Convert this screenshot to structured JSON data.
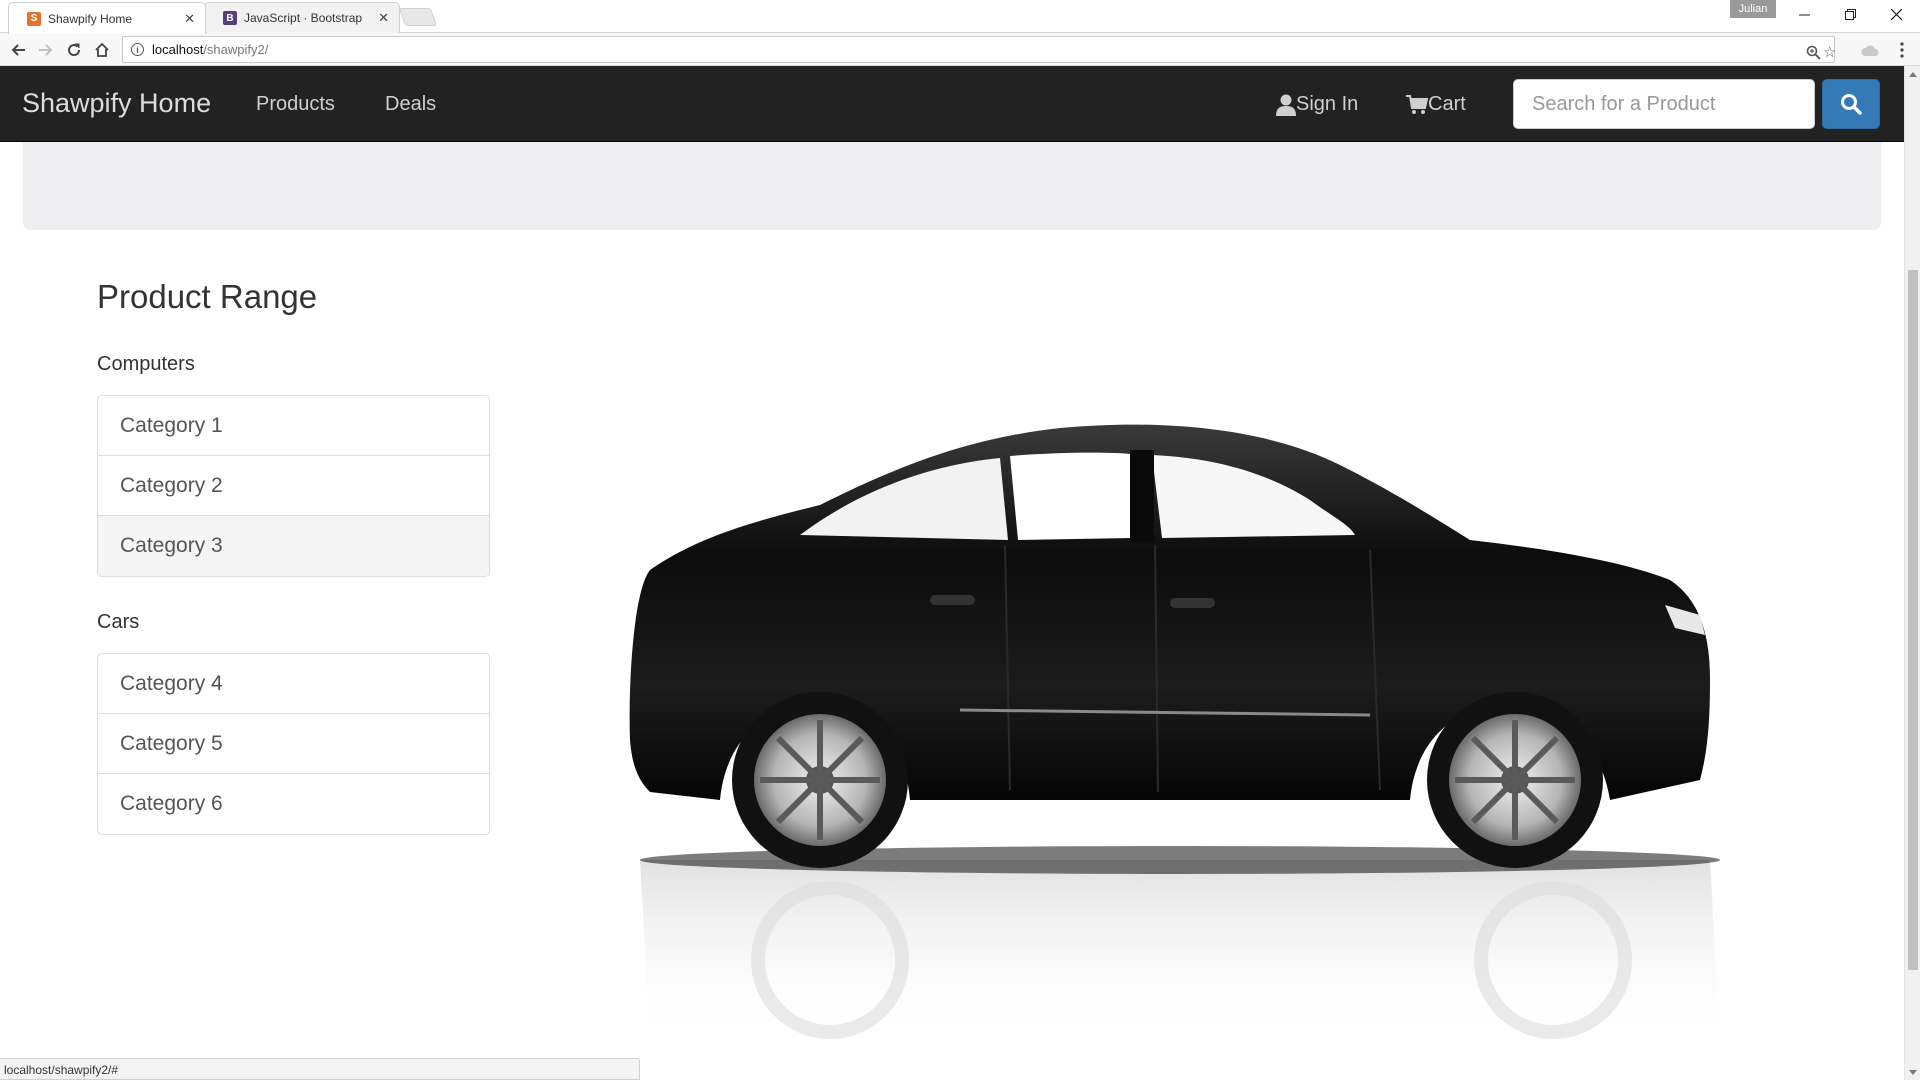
{
  "browser": {
    "tabs": [
      {
        "title": "Shawpify Home",
        "favicon_color": "#e2732b",
        "favicon_glyph": "S",
        "active": true
      },
      {
        "title": "JavaScript · Bootstrap",
        "favicon_color": "#563d7c",
        "favicon_glyph": "B",
        "active": false
      }
    ],
    "profile_name": "Julian",
    "address": {
      "host": "localhost",
      "path": "/shawpify2/"
    },
    "status_url": "localhost/shawpify2/#"
  },
  "navbar": {
    "brand": "Shawpify Home",
    "links": [
      "Products",
      "Deals"
    ],
    "sign_in": "Sign In",
    "cart": "Cart",
    "search_placeholder": "Search for a Product",
    "accent_color": "#337ab7"
  },
  "main": {
    "title": "Product Range",
    "groups": [
      {
        "heading": "Computers",
        "items": [
          "Category 1",
          "Category 2",
          "Category 3"
        ],
        "hovered_index": 2
      },
      {
        "heading": "Cars",
        "items": [
          "Category 4",
          "Category 5",
          "Category 6"
        ],
        "hovered_index": null
      }
    ],
    "hero_image": "black-sedan-car"
  }
}
